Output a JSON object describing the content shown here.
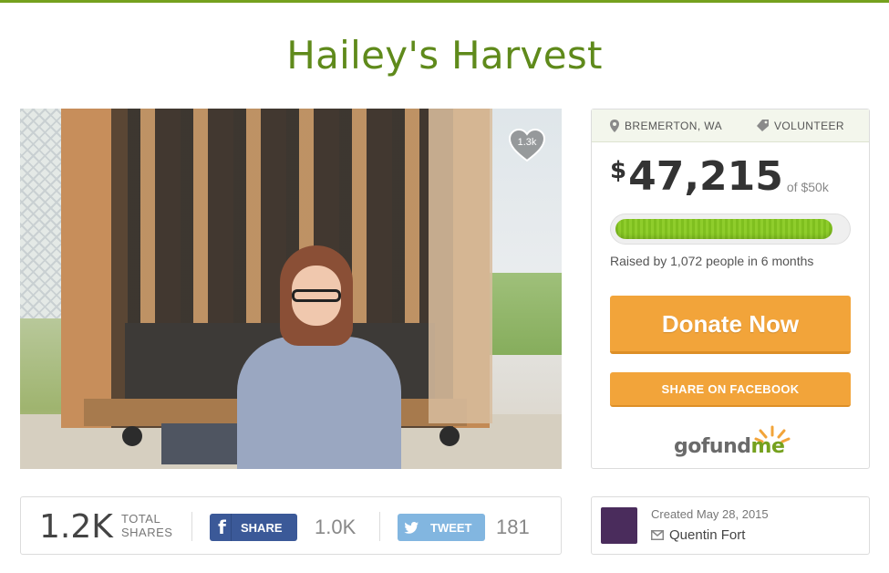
{
  "campaign": {
    "title": "Hailey's Harvest"
  },
  "photo": {
    "favorites_count": "1.3k"
  },
  "meta": {
    "location": "BREMERTON, WA",
    "category": "VOLUNTEER"
  },
  "funding": {
    "currency": "$",
    "raised": "47,215",
    "goal": "of $50k",
    "progress_fraction": 0.944,
    "raised_by_text": "Raised by 1,072 people in 6 months"
  },
  "actions": {
    "donate_label": "Donate Now",
    "facebook_label": "SHARE ON FACEBOOK"
  },
  "logo": {
    "go": "gofund",
    "me": "me"
  },
  "shares": {
    "total": "1.2K",
    "total_label_line1": "TOTAL",
    "total_label_line2": "SHARES",
    "fb_share_label": "SHARE",
    "fb_icon_glyph": "f",
    "fb_count": "1.0K",
    "tweet_label": "TWEET",
    "tweet_count": "181"
  },
  "organizer": {
    "created": "Created May 28, 2015",
    "name": "Quentin Fort"
  },
  "colors": {
    "brand_green": "#5f8a1b",
    "donate_orange": "#f2a43a",
    "facebook_blue": "#3b5998",
    "twitter_blue": "#82b6e0",
    "progress_green": "#7fbf1f"
  },
  "icons": [
    "pin-icon",
    "tag-icon",
    "heart-icon",
    "facebook-icon",
    "twitter-bird-icon",
    "mail-icon",
    "gofundme-sun-icon"
  ]
}
